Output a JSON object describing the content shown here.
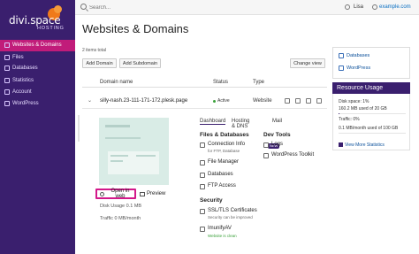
{
  "brand": {
    "name": "divi.space",
    "sub": "HOSTING"
  },
  "sidebar": {
    "items": [
      {
        "label": "Websites & Domains",
        "icon": "globe-icon",
        "active": true
      },
      {
        "label": "Files",
        "icon": "folder-icon",
        "active": false
      },
      {
        "label": "Databases",
        "icon": "database-icon",
        "active": false
      },
      {
        "label": "Statistics",
        "icon": "chart-icon",
        "active": false
      },
      {
        "label": "Account",
        "icon": "user-icon",
        "active": false
      },
      {
        "label": "WordPress",
        "icon": "wordpress-icon",
        "active": false
      }
    ]
  },
  "topbar": {
    "search_placeholder": "Search...",
    "user_name": "Lisa",
    "domain_link": "example.com"
  },
  "main": {
    "title": "Websites & Domains",
    "items_total": "2 items total",
    "buttons": {
      "add_domain": "Add Domain",
      "add_subdomain": "Add Subdomain",
      "change_view": "Change view"
    },
    "table": {
      "headers": {
        "name": "Domain name",
        "status": "Status",
        "type": "Type"
      },
      "row": {
        "name": "silly-nash.23-111-171-172.plesk.page",
        "status": "Active",
        "type": "Website"
      }
    },
    "site": {
      "open_in_web": "Open in web",
      "preview": "Preview",
      "disk_usage": "Disk Usage 0.1 MB",
      "traffic": "Traffic 0 MB/month"
    },
    "tabs": [
      "Dashboard",
      "Hosting & DNS",
      "Mail"
    ],
    "files_db": {
      "title": "Files & Databases",
      "connection_info": "Connection Info",
      "connection_sub": "for FTP, Database",
      "new_badge": "NEW",
      "file_manager": "File Manager",
      "databases": "Databases",
      "ftp_access": "FTP Access"
    },
    "dev_tools": {
      "title": "Dev Tools",
      "logs": "Logs",
      "wp_toolkit": "WordPress Toolkit"
    },
    "security": {
      "title": "Security",
      "ssl": "SSL/TLS Certificates",
      "ssl_sub": "Security can be improved",
      "imunify": "ImunifyAV",
      "imunify_sub": "Website is clean"
    }
  },
  "right": {
    "links": {
      "databases": "Databases",
      "wordpress": "WordPress"
    },
    "resource": {
      "title": "Resource Usage",
      "disk_space": "Disk space: 1%",
      "disk_amount": "160.2 MB used of 20 GB",
      "traffic": "Traffic: 0%",
      "traffic_amount": "0.1 MB/month used of 100 GB",
      "more": "View More Statistics",
      "disk_fraction": 0.01,
      "traffic_fraction": 0.0
    }
  },
  "colors": {
    "sidebar": "#3a1f6e",
    "active": "#c11c7a",
    "highlight": "#d3188a",
    "link": "#0a4f9a"
  }
}
